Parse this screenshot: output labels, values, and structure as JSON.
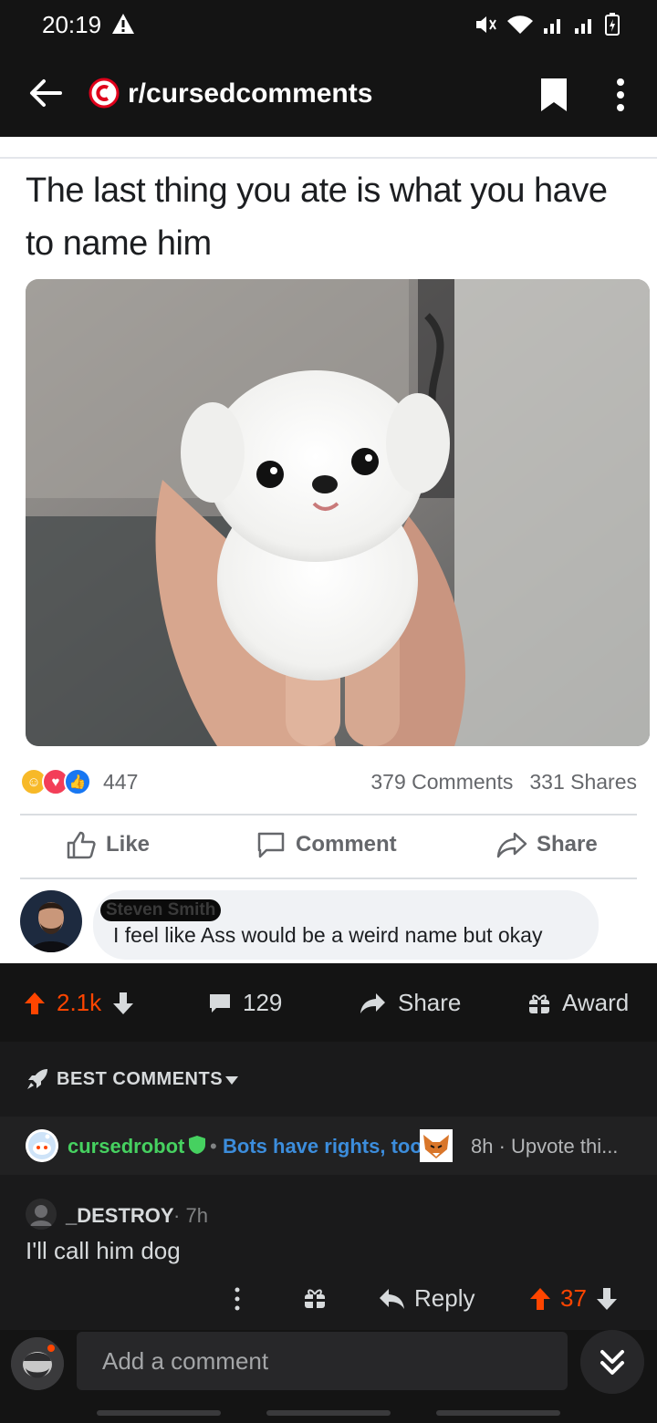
{
  "status_bar": {
    "time": "20:19"
  },
  "header": {
    "subreddit": "r/cursedcomments"
  },
  "post": {
    "fb_text": "The last thing you ate is what you have to name him",
    "reaction_count": "447",
    "comments_count": "379 Comments",
    "shares_count": "331 Shares",
    "like_label": "Like",
    "comment_label": "Comment",
    "share_label": "Share",
    "fb_comment_author": "Steven Smith",
    "fb_comment_text": "I feel like Ass would be a weird name but okay"
  },
  "post_bar": {
    "score": "2.1k",
    "comment_count": "129",
    "share_label": "Share",
    "award_label": "Award"
  },
  "sort": {
    "label": "BEST COMMENTS"
  },
  "bot_comment": {
    "username": "cursedrobot",
    "flair": "Bots have rights, too!",
    "meta": "8h · Upvote thi..."
  },
  "comment": {
    "username": "_DESTROY",
    "age": "7h",
    "body": "I'll call him dog",
    "reply_label": "Reply",
    "score": "37"
  },
  "input": {
    "placeholder": "Add a comment"
  },
  "colors": {
    "upvote": "#ff4500",
    "bot_name": "#46d160",
    "flair": "#3c8ddc",
    "fb_like": "#1877f2"
  }
}
